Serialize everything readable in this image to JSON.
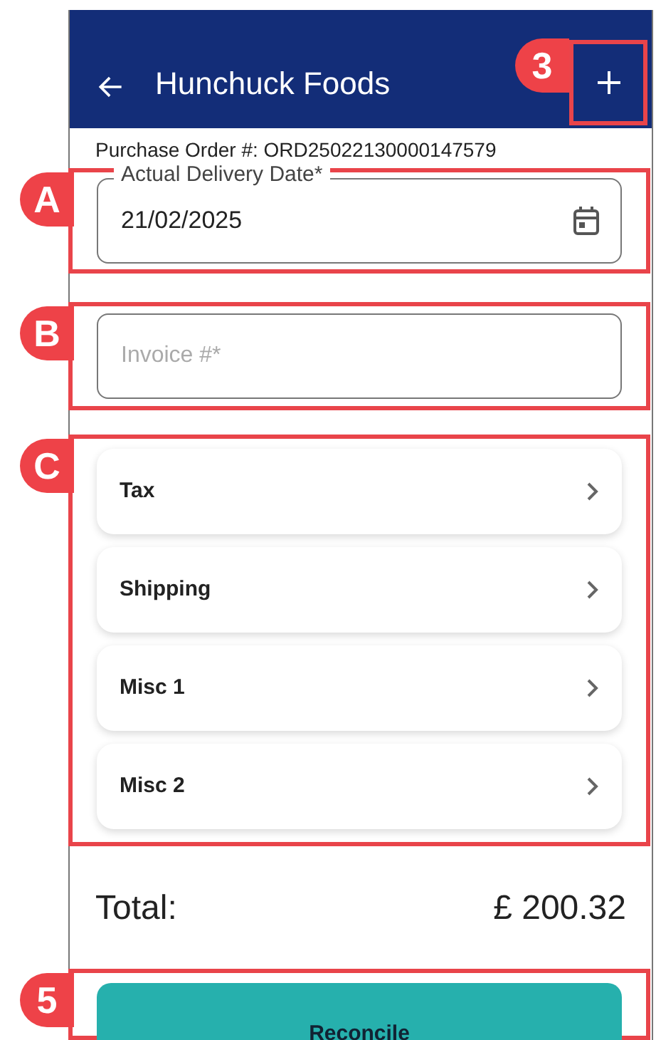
{
  "header": {
    "title": "Hunchuck Foods",
    "callout": "3"
  },
  "purchase_order": "Purchase Order #: ORD25022130000147579",
  "delivery_date": {
    "callout": "A",
    "label": "Actual Delivery Date*",
    "value": "21/02/2025"
  },
  "invoice": {
    "callout": "B",
    "placeholder": "Invoice #*"
  },
  "charges": {
    "callout": "C",
    "items": [
      {
        "label": "Tax"
      },
      {
        "label": "Shipping"
      },
      {
        "label": "Misc 1"
      },
      {
        "label": "Misc 2"
      }
    ]
  },
  "total": {
    "label": "Total:",
    "amount": "£ 200.32"
  },
  "reconcile": {
    "callout": "5",
    "label": "Reconcile"
  }
}
